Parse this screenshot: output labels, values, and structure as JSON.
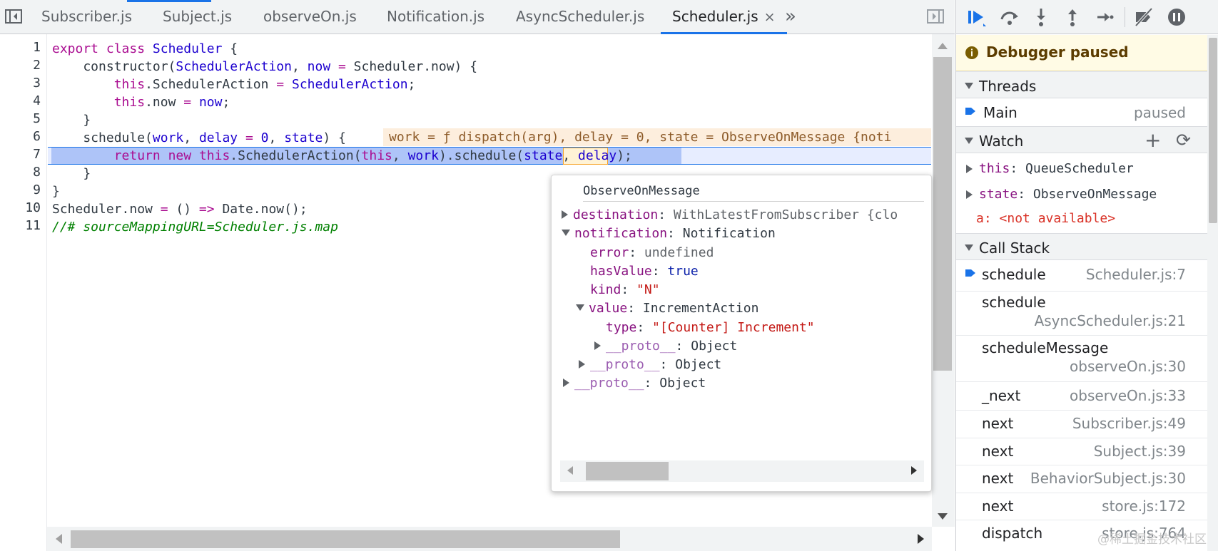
{
  "tabs": [
    {
      "label": "Subscriber.js",
      "active": false
    },
    {
      "label": "Subject.js",
      "active": false
    },
    {
      "label": "observeOn.js",
      "active": false
    },
    {
      "label": "Notification.js",
      "active": false
    },
    {
      "label": "AsyncScheduler.js",
      "active": false
    },
    {
      "label": "Scheduler.js",
      "active": true
    }
  ],
  "tab_close_glyph": "×",
  "tab_overflow_glyph": "»",
  "code": {
    "line_numbers": [
      "1",
      "2",
      "3",
      "4",
      "5",
      "6",
      "7",
      "8",
      "9",
      "10",
      "11"
    ],
    "l1": {
      "a": "export",
      "b": " ",
      "c": "class",
      "d": " ",
      "e": "Scheduler",
      "f": " {"
    },
    "l2": {
      "a": "    constructor(",
      "b": "SchedulerAction",
      "c": ", ",
      "d": "now",
      "e": " ",
      "f": "=",
      "g": " Scheduler.now) {"
    },
    "l3": {
      "a": "        ",
      "b": "this",
      "c": ".SchedulerAction ",
      "d": "=",
      "e": " ",
      "f": "SchedulerAction",
      "g": ";"
    },
    "l4": {
      "a": "        ",
      "b": "this",
      "c": ".now ",
      "d": "=",
      "e": " ",
      "f": "now",
      "g": ";"
    },
    "l5": {
      "a": "    }"
    },
    "l6": {
      "a": "    schedule(",
      "b": "work",
      "c": ", ",
      "d": "delay",
      "e": " ",
      "f": "=",
      "g": " ",
      "h": "0",
      "i": ", ",
      "j": "state",
      "k": ") {"
    },
    "l7": {
      "a": "        ",
      "b": "return",
      "c": " ",
      "d": "new",
      "e": " ",
      "f": "this",
      "g": ".SchedulerAction(",
      "h": "this",
      "i": ", ",
      "j": "work",
      "k": ").schedule(",
      "l": "state",
      "m": ", ",
      "n": "delay",
      "o": ");"
    },
    "l8": {
      "a": "    }"
    },
    "l9": {
      "a": "}"
    },
    "l10": {
      "a": "Scheduler.now ",
      "b": "=",
      "c": " () ",
      "d": "=>",
      "e": " Date.now();"
    },
    "l11": {
      "a": "//# sourceMappingURL=Scheduler.js.map"
    }
  },
  "inline_values": "work = ƒ dispatch(arg), delay = 0, state = ObserveOnMessage {noti",
  "popover": {
    "title": "ObserveOnMessage",
    "rows": [
      {
        "key": "destination",
        "sep": ": ",
        "value": "WithLatestFromSubscriber {clo"
      },
      {
        "key": "notification",
        "sep": ": ",
        "value": "Notification"
      },
      {
        "key": "error",
        "sep": ": ",
        "value": "undefined"
      },
      {
        "key": "hasValue",
        "sep": ": ",
        "value": "true"
      },
      {
        "key": "kind",
        "sep": ": ",
        "value": "\"N\""
      },
      {
        "key": "value",
        "sep": ": ",
        "value": "IncrementAction"
      },
      {
        "key": "type",
        "sep": ": ",
        "value": "\"[Counter] Increment\""
      },
      {
        "key": "__proto__",
        "sep": ": ",
        "value": "Object"
      },
      {
        "key": "__proto__",
        "sep": ": ",
        "value": "Object"
      },
      {
        "key": "__proto__",
        "sep": ": ",
        "value": "Object"
      }
    ]
  },
  "sidebar": {
    "banner": "Debugger paused",
    "threads": {
      "title": "Threads",
      "main": "Main",
      "status": "paused"
    },
    "watch": {
      "title": "Watch",
      "add_glyph": "+",
      "refresh_glyph": "⟳",
      "items": [
        {
          "key": "this",
          "sep": ": ",
          "value": "QueueScheduler"
        },
        {
          "key": "state",
          "sep": ": ",
          "value": "ObserveOnMessage"
        },
        {
          "key": "a",
          "sep": ": ",
          "value": "<not available>"
        }
      ]
    },
    "callstack": {
      "title": "Call Stack",
      "frames": [
        {
          "name": "schedule",
          "loc": "Scheduler.js:7"
        },
        {
          "name": "schedule",
          "loc": "AsyncScheduler.js:21"
        },
        {
          "name": "scheduleMessage",
          "loc": "observeOn.js:30"
        },
        {
          "name": "_next",
          "loc": "observeOn.js:33"
        },
        {
          "name": "next",
          "loc": "Subscriber.js:49"
        },
        {
          "name": "next",
          "loc": "Subject.js:39"
        },
        {
          "name": "next",
          "loc": "BehaviorSubject.js:30"
        },
        {
          "name": "next",
          "loc": "store.js:172"
        },
        {
          "name": "dispatch",
          "loc": "store.js:764"
        }
      ]
    }
  },
  "watermark": "@稀土掘金技术社区",
  "colors": {
    "accent": "#1a73e8",
    "paused_bg": "#fffbe5",
    "exec_line": "#e7edff"
  }
}
